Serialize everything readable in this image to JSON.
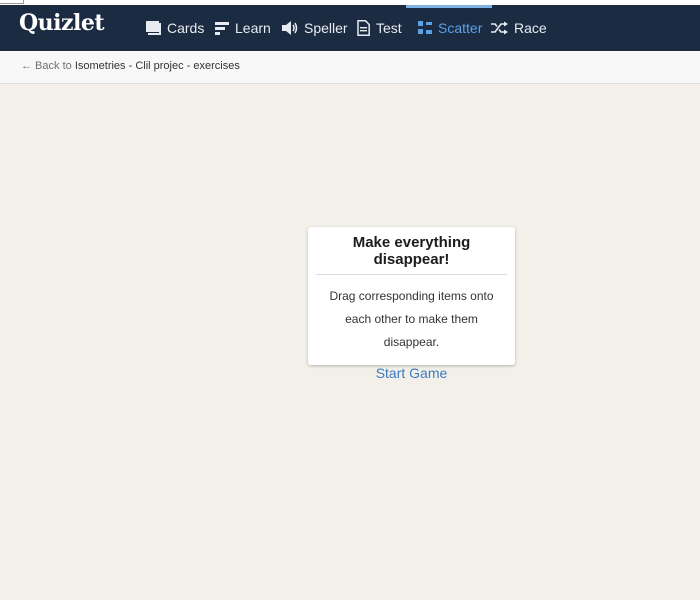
{
  "app": {
    "logo": "Quizlet"
  },
  "nav": {
    "items": [
      {
        "label": "Cards",
        "icon": "cards-icon",
        "active": false
      },
      {
        "label": "Learn",
        "icon": "learn-icon",
        "active": false
      },
      {
        "label": "Speller",
        "icon": "speaker-icon",
        "active": false
      },
      {
        "label": "Test",
        "icon": "document-icon",
        "active": false
      },
      {
        "label": "Scatter",
        "icon": "scatter-icon",
        "active": true
      },
      {
        "label": "Race",
        "icon": "shuffle-icon",
        "active": false
      }
    ]
  },
  "breadcrumb": {
    "back_text": "← Back to",
    "set_title": "Isometries - Clil projec - exercises"
  },
  "modal": {
    "title": "Make everything disappear!",
    "description": "Drag corresponding items onto each other to make them disappear.",
    "start_label": "Start Game"
  },
  "colors": {
    "navbar": "#1b2b41",
    "background": "#f3f0ea",
    "accent": "#3a7bbf",
    "active_tab": "#5aa1e6"
  }
}
